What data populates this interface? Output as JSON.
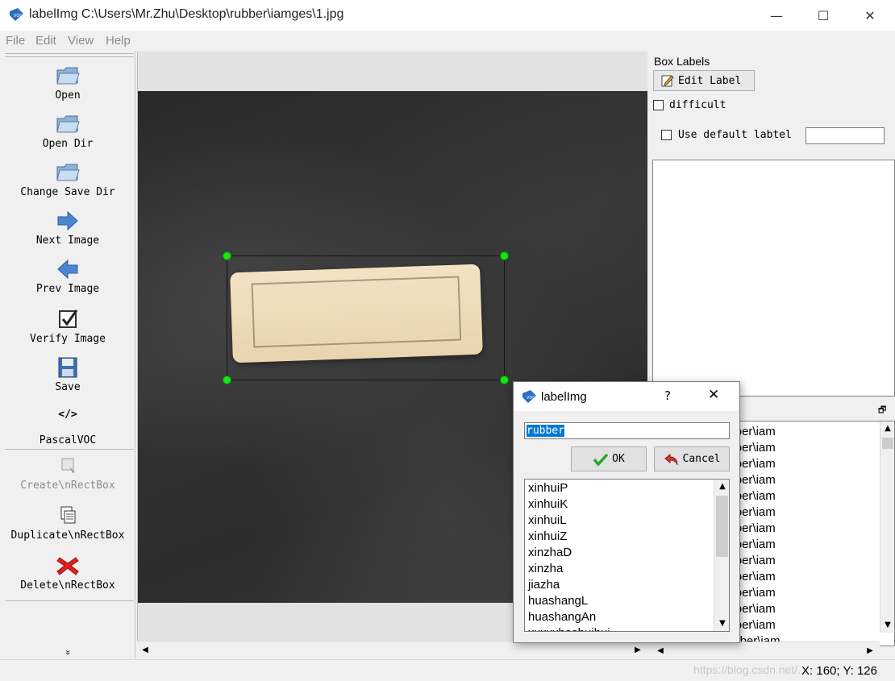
{
  "window": {
    "title": "labelImg C:\\Users\\Mr.Zhu\\Desktop\\rubber\\iamges\\1.jpg",
    "minimize": "—",
    "maximize": "☐",
    "close": "✕"
  },
  "menu": [
    "File",
    "Edit",
    "View",
    "Help"
  ],
  "toolbar": {
    "open": "Open",
    "open_dir": "Open Dir",
    "change_save_dir": "Change Save Dir",
    "next_image": "Next Image",
    "prev_image": "Prev Image",
    "verify_image": "Verify Image",
    "save": "Save",
    "format_icon": "</>",
    "format": "PascalVOC",
    "create_rect": "Create\\nRectBox",
    "duplicate_rect": "Duplicate\\nRectBox",
    "delete_rect": "Delete\\nRectBox",
    "more": "»"
  },
  "box_labels": {
    "title": "Box Labels",
    "edit_label": "Edit Label",
    "difficult": "difficult",
    "use_default": "Use default labtel",
    "default_value": ""
  },
  "file_list": {
    "items": [
      "nu\\Desktop\\rubber\\iam",
      "nu\\Desktop\\rubber\\iam",
      "nu\\Desktop\\rubber\\iam",
      "nu\\Desktop\\rubber\\iam",
      "nu\\Desktop\\rubber\\iam",
      "nu\\Desktop\\rubber\\iam",
      "nu\\Desktop\\rubber\\iam",
      "nu\\Desktop\\rubber\\iam",
      "nu\\Desktop\\rubber\\iam",
      "nu\\Desktop\\rubber\\iam",
      "nu\\Desktop\\rubber\\iam",
      "nu\\Desktop\\rubber\\iam",
      "nu\\Desktop\\rubber\\iam",
      "nu\\Desktop\\Rubber\\iam"
    ]
  },
  "dialog": {
    "title": "labelImg",
    "help": "?",
    "close": "✕",
    "input_value": "rubber",
    "ok": "OK",
    "cancel": "Cancel",
    "options": [
      "xinhuiP",
      "xinhuiK",
      "xinhuiL",
      "xinhuiZ",
      "xinzhaD",
      "xinzha",
      "jiazha",
      "huashangL",
      "huashangAn",
      "xxxxxhashuihui"
    ]
  },
  "status": {
    "coords": "X: 160; Y: 126",
    "watermark": "https://blog.csdn.net/..."
  },
  "colors": {
    "handle": "#17e317",
    "selection": "#0078d7"
  }
}
